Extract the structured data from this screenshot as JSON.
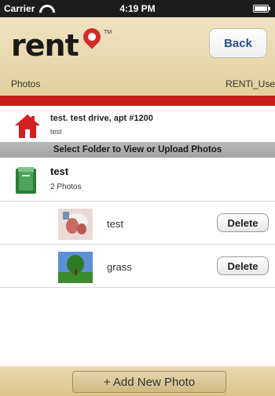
{
  "status_bar": {
    "carrier": "Carrier",
    "time": "4:19 PM"
  },
  "header": {
    "logo_text": "rent",
    "logo_tm": "TM",
    "back_label": "Back",
    "breadcrumb_left": "Photos",
    "breadcrumb_right": "RENTi_Use"
  },
  "address": {
    "line1": "test. test drive, apt #1200",
    "line2": "test"
  },
  "section_label": "Select Folder to View or Upload Photos",
  "folder": {
    "title": "test",
    "subtitle": "2 Photos"
  },
  "photos": [
    {
      "name": "test",
      "delete_label": "Delete"
    },
    {
      "name": "grass",
      "delete_label": "Delete"
    }
  ],
  "footer": {
    "add_label": "+ Add New Photo"
  },
  "colors": {
    "accent_red": "#cc1b1b",
    "header_tan": "#e3cf9c",
    "link_blue": "#2a4f8a"
  }
}
